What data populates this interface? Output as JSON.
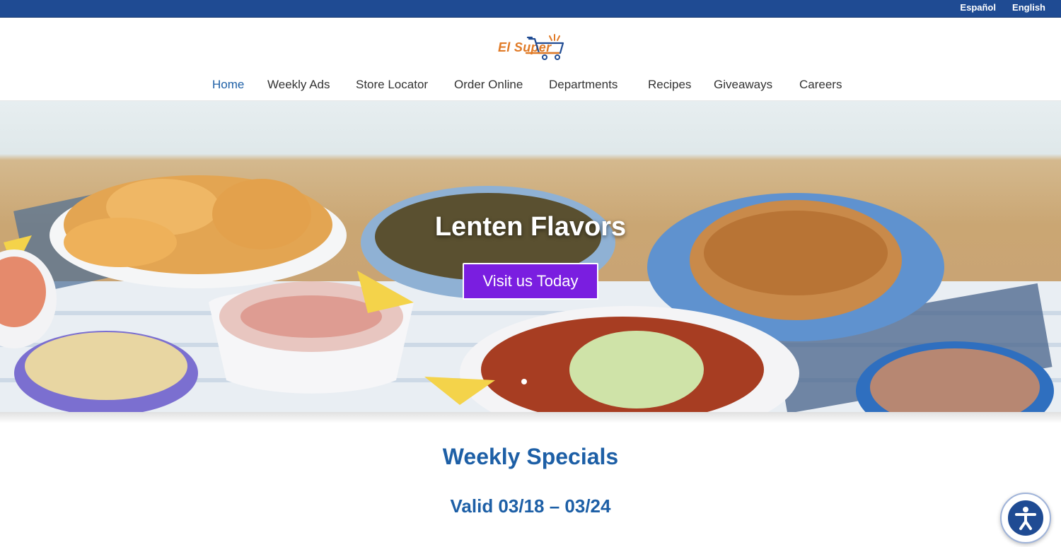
{
  "topbar": {
    "lang_es": "Español",
    "lang_en": "English",
    "color": "#1f4b93"
  },
  "brand": {
    "logo_text": "El Super",
    "icon": "shopping-cart-icon"
  },
  "nav": {
    "items": [
      {
        "label": "Home",
        "active": true
      },
      {
        "label": "Weekly Ads"
      },
      {
        "label": "Store Locator"
      },
      {
        "label": "Order Online"
      },
      {
        "label": "Departments"
      },
      {
        "label": "Recipes"
      },
      {
        "label": "Giveaways"
      },
      {
        "label": "Careers"
      }
    ]
  },
  "hero": {
    "title": "Lenten Flavors",
    "button_label": "Visit us Today",
    "button_color": "#7a1ee0"
  },
  "specials": {
    "title": "Weekly Specials",
    "valid": "Valid 03/18 – 03/24",
    "color": "#1d5fa6"
  },
  "accessibility": {
    "icon": "accessibility-icon"
  }
}
